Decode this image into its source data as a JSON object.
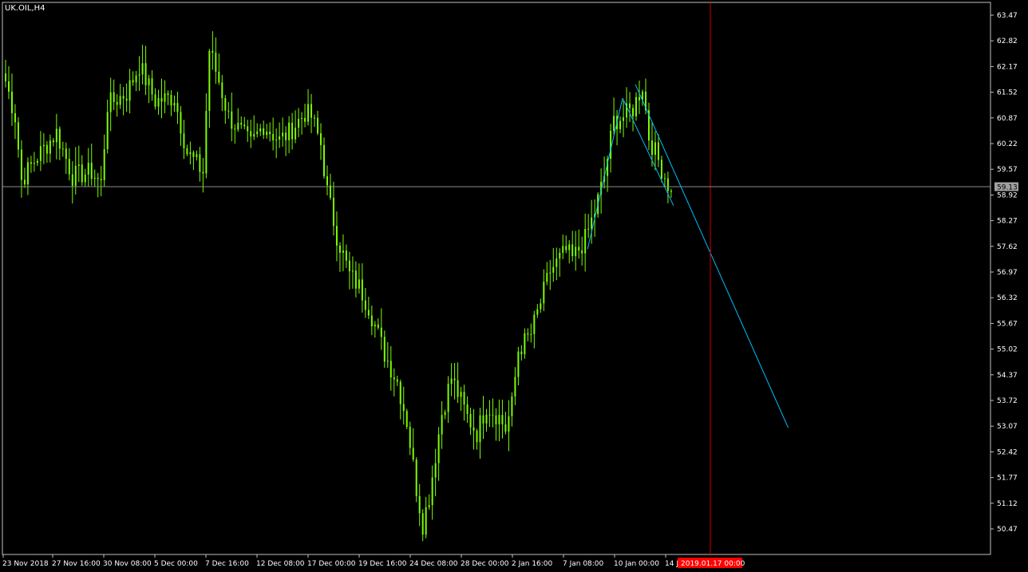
{
  "symbol_label": "UK.OIL,H4",
  "colors": {
    "background": "#000000",
    "frame": "#c0c0c0",
    "candle": "#7cfc00",
    "trendline": "#00bfff",
    "price_line": "#8c8c8c",
    "cursor_line": "#d20000",
    "date_badge_bg": "#ff0000",
    "price_badge_bg": "#a0a0a0"
  },
  "chart_data": {
    "type": "candlestick",
    "timeframe": "H4",
    "y_ticks": [
      "63.47",
      "62.82",
      "62.17",
      "61.52",
      "60.87",
      "60.22",
      "59.57",
      "58.92",
      "58.27",
      "57.62",
      "56.97",
      "56.32",
      "55.67",
      "55.02",
      "54.37",
      "53.72",
      "53.07",
      "52.42",
      "51.77",
      "51.12",
      "50.47"
    ],
    "ylim": [
      50.2,
      63.75
    ],
    "x_ticks": [
      "23 Nov 2018",
      "27 Nov 16:00",
      "30 Nov 08:00",
      "5 Dec 00:00",
      "7 Dec 16:00",
      "12 Dec 08:00",
      "17 Dec 00:00",
      "19 Dec 16:00",
      "24 Dec 08:00",
      "28 Dec 00:00",
      "2 Jan 16:00",
      "7 Jan 08:00",
      "10 Jan 00:00",
      "14 J"
    ],
    "current_price": "59.13",
    "cursor_date": "2019.01.17 00:00",
    "close_waypoints": [
      [
        0,
        61.8
      ],
      [
        3,
        60.9
      ],
      [
        5,
        59.3
      ],
      [
        10,
        59.9
      ],
      [
        16,
        60.5
      ],
      [
        21,
        59.4
      ],
      [
        27,
        59.5
      ],
      [
        30,
        59.2
      ],
      [
        32,
        61.2
      ],
      [
        38,
        61.5
      ],
      [
        42,
        62.2
      ],
      [
        47,
        61.3
      ],
      [
        53,
        61.4
      ],
      [
        57,
        60.0
      ],
      [
        62,
        59.5
      ],
      [
        64,
        62.6
      ],
      [
        67,
        61.8
      ],
      [
        70,
        60.9
      ],
      [
        77,
        60.2
      ],
      [
        81,
        60.7
      ],
      [
        86,
        60.3
      ],
      [
        89,
        60.5
      ],
      [
        94,
        61.0
      ],
      [
        96,
        60.9
      ],
      [
        99,
        60.2
      ],
      [
        101,
        59.0
      ],
      [
        104,
        57.9
      ],
      [
        108,
        56.9
      ],
      [
        111,
        56.6
      ],
      [
        114,
        56.1
      ],
      [
        119,
        54.9
      ],
      [
        123,
        54.2
      ],
      [
        126,
        53.2
      ],
      [
        129,
        51.5
      ],
      [
        131,
        50.6
      ],
      [
        133,
        51.3
      ],
      [
        137,
        53.4
      ],
      [
        140,
        54.3
      ],
      [
        145,
        53.3
      ],
      [
        148,
        52.9
      ],
      [
        151,
        53.6
      ],
      [
        155,
        53.3
      ],
      [
        157,
        53.0
      ],
      [
        159,
        53.6
      ],
      [
        161,
        55.0
      ],
      [
        165,
        55.4
      ],
      [
        168,
        56.2
      ],
      [
        171,
        57.0
      ],
      [
        176,
        57.5
      ],
      [
        178,
        57.3
      ],
      [
        182,
        57.8
      ],
      [
        185,
        58.5
      ],
      [
        188,
        59.4
      ],
      [
        191,
        60.8
      ],
      [
        194,
        60.9
      ],
      [
        197,
        61.1
      ],
      [
        200,
        61.7
      ],
      [
        202,
        60.4
      ],
      [
        206,
        59.6
      ],
      [
        209,
        59.0
      ]
    ],
    "trendlines": [
      {
        "from": [
          183,
          57.55
        ],
        "to": [
          194,
          61.37
        ]
      },
      {
        "from": [
          194,
          61.37
        ],
        "to": [
          210,
          58.65
        ]
      },
      {
        "from": [
          198,
          61.72
        ],
        "to": [
          246,
          53.03
        ]
      }
    ]
  }
}
